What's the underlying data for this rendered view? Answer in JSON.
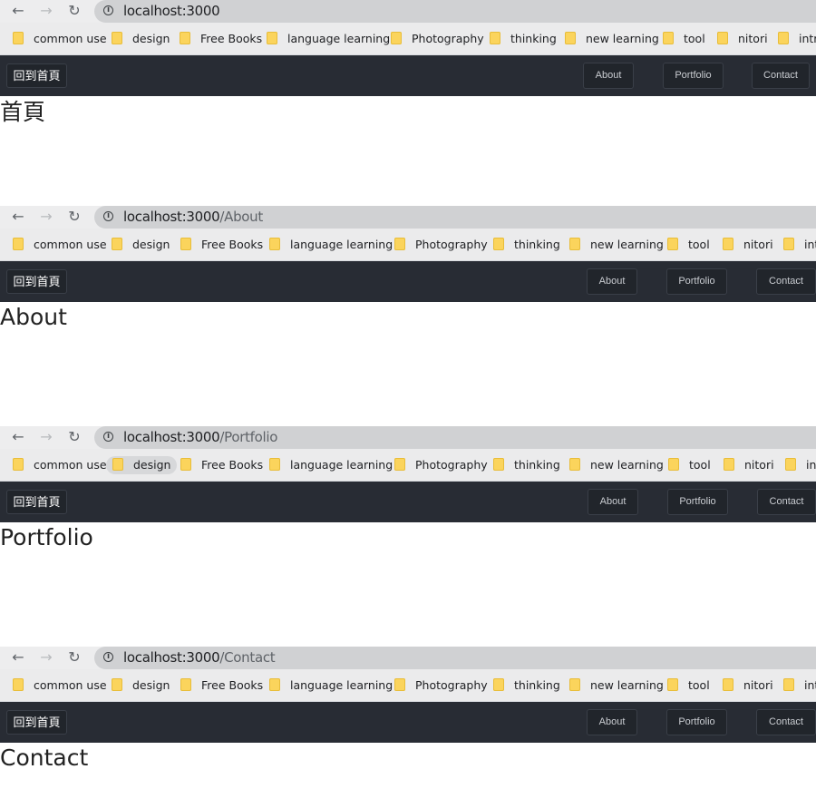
{
  "bookmarks": [
    "common use",
    "design",
    "Free Books",
    "language learning",
    "Photography",
    "thinking",
    "new learning",
    "tool",
    "nitori",
    "intr"
  ],
  "icons": {
    "back": "←",
    "forward": "→",
    "reload": "↻",
    "info": "i"
  },
  "colors": {
    "navbar": "#282c34",
    "button": "#21252b",
    "folder": "#fbd45c"
  },
  "screens": [
    {
      "url_host": "localhost:3000",
      "url_path": "",
      "home_label": "回到首頁",
      "nav": [
        "About",
        "Portfolio",
        "Contact"
      ],
      "heading": "首頁"
    },
    {
      "url_host": "localhost:3000",
      "url_path": "/About",
      "home_label": "回到首頁",
      "nav": [
        "About",
        "Portfolio",
        "Contact"
      ],
      "heading": "About"
    },
    {
      "url_host": "localhost:3000",
      "url_path": "/Portfolio",
      "home_label": "回到首頁",
      "nav": [
        "About",
        "Portfolio",
        "Contact"
      ],
      "heading": "Portfolio"
    },
    {
      "url_host": "localhost:3000",
      "url_path": "/Contact",
      "home_label": "回到首頁",
      "nav": [
        "About",
        "Portfolio",
        "Contact"
      ],
      "heading": "Contact"
    }
  ]
}
